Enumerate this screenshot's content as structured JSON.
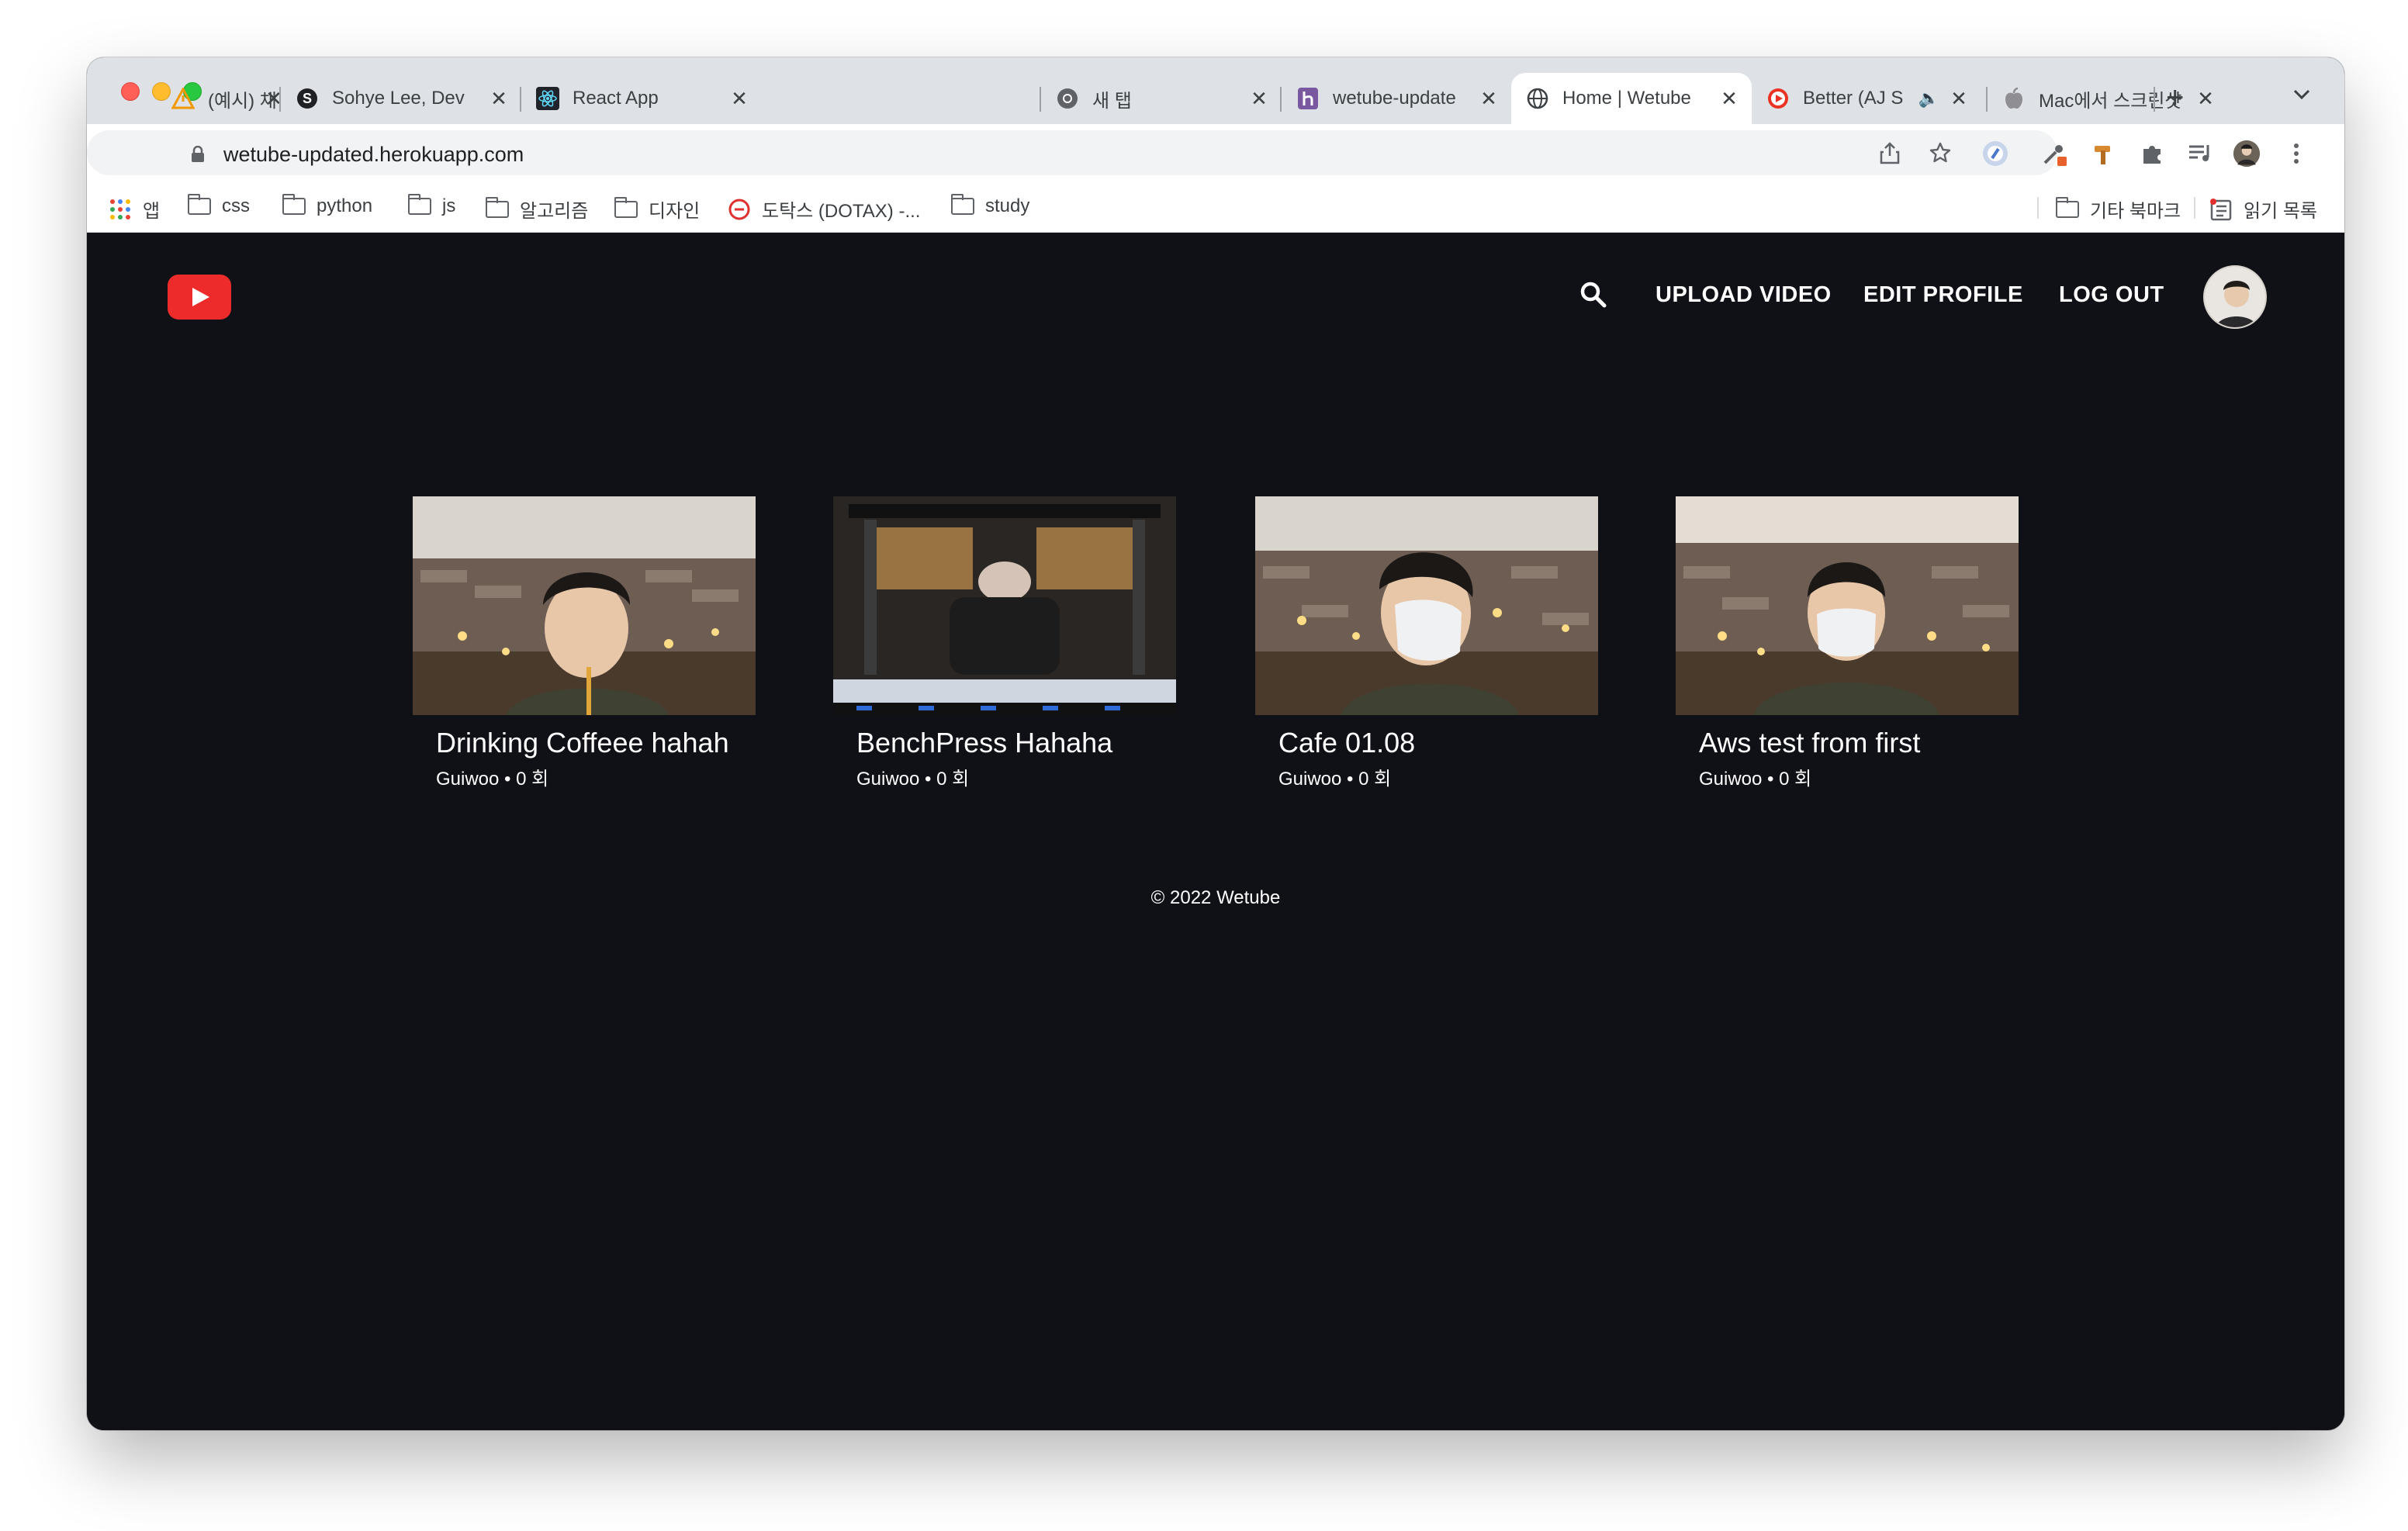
{
  "browser": {
    "tabs": [
      {
        "title": "(예시) 채용 리스트",
        "icon": "warning-triangle-icon"
      },
      {
        "title": "Sohye Lee, Dev",
        "icon": "s-logo-icon"
      },
      {
        "title": "React App",
        "icon": "react-logo-icon"
      },
      {
        "title": "새 탭",
        "icon": "chrome-icon"
      },
      {
        "title": "wetube-update",
        "icon": "heroku-icon"
      },
      {
        "title": "Home | Wetube",
        "icon": "globe-icon",
        "active": true
      },
      {
        "title": "Better (AJ S",
        "icon": "record-icon"
      },
      {
        "title": "Mac에서 스크린샷",
        "icon": "apple-icon"
      }
    ],
    "close_glyph": "✕",
    "new_tab_glyph": "+",
    "url": "wetube-updated.herokuapp.com",
    "bookmarks": [
      {
        "label": "앱",
        "type": "apps"
      },
      {
        "label": "css",
        "type": "folder"
      },
      {
        "label": "python",
        "type": "folder"
      },
      {
        "label": "js",
        "type": "folder"
      },
      {
        "label": "알고리즘",
        "type": "folder"
      },
      {
        "label": "디자인",
        "type": "folder"
      },
      {
        "label": "도탁스 (DOTAX) -...",
        "type": "site"
      },
      {
        "label": "study",
        "type": "folder"
      }
    ],
    "other_bookmarks": "기타 북마크",
    "reading_list": "읽기 목록"
  },
  "header": {
    "upload_label": "UPLOAD VIDEO",
    "edit_profile_label": "EDIT PROFILE",
    "logout_label": "LOG OUT"
  },
  "videos": [
    {
      "title": "Drinking Coffeee hahah",
      "meta": "Guiwoo • 0 회"
    },
    {
      "title": "BenchPress Hahaha",
      "meta": "Guiwoo • 0 회"
    },
    {
      "title": "Cafe 01.08",
      "meta": "Guiwoo • 0 회"
    },
    {
      "title": "Aws test from first",
      "meta": "Guiwoo • 0 회"
    }
  ],
  "footer": {
    "text": "© 2022 Wetube"
  },
  "colors": {
    "brand": "#ee2b2b",
    "page_bg": "#101117"
  }
}
